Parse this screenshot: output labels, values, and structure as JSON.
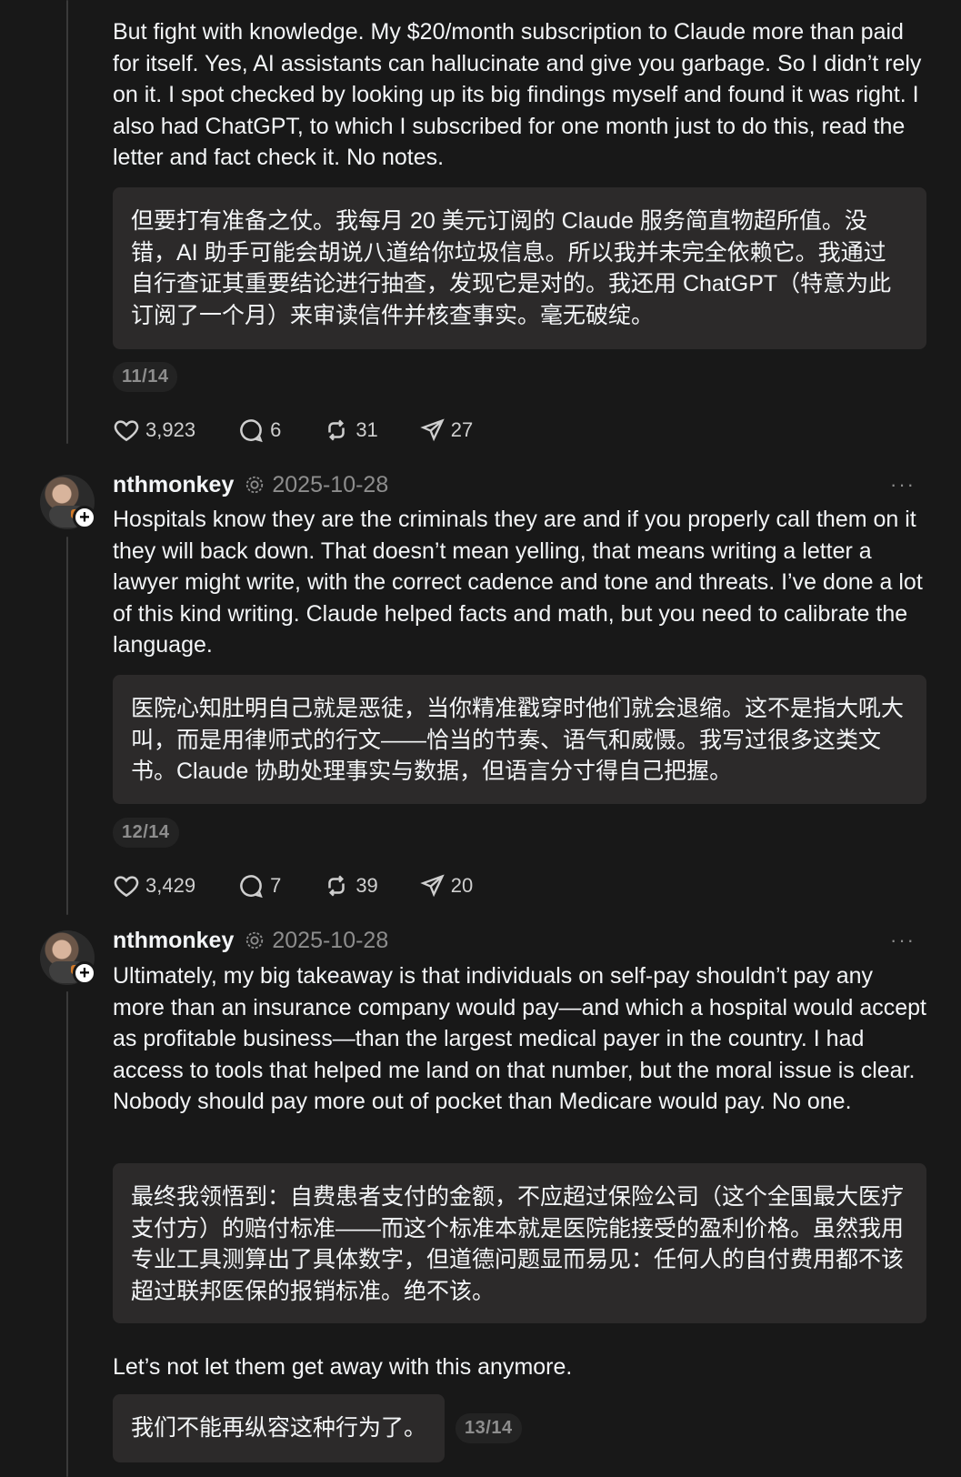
{
  "posts": [
    {
      "body": "But fight with knowledge. My $20/month subscription to Claude more than paid for itself. Yes, AI assistants can hallucinate and give you garbage. So I didn’t rely on it. I spot checked by looking up its big findings myself and found it was right. I also had ChatGPT, to which I subscribed for one month just to do this, read the letter and fact check it. No notes.",
      "translation": "但要打有准备之仗。我每月 20 美元订阅的 Claude 服务简直物超所值。没错，AI 助手可能会胡说八道给你垃圾信息。所以我并未完全依赖它。我通过自行查证其重要结论进行抽查，发现它是对的。我还用 ChatGPT（特意为此订阅了一个月）来审读信件并核查事实。毫无破绽。",
      "page": "11/14",
      "likes": "3,923",
      "replies": "6",
      "reposts": "31",
      "shares": "27"
    },
    {
      "username": "nthmonkey",
      "date": "2025-10-28",
      "body": "Hospitals know they are the criminals they are and if you properly call them on it they will back down. That doesn’t mean yelling, that means writing a letter a lawyer might write, with the correct cadence and tone and threats. I’ve done a lot of this kind writing. Claude helped        facts and math, but you need to calibrate the language.",
      "translation": "医院心知肚明自己就是恶徒，当你精准戳穿时他们就会退缩。这不是指大吼大叫，而是用律师式的行文——恰当的节奏、语气和威慑。我写过很多这类文书。Claude 协助处理事实与数据，但语言分寸得自己把握。",
      "page": "12/14",
      "likes": "3,429",
      "replies": "7",
      "reposts": "39",
      "shares": "20"
    },
    {
      "username": "nthmonkey",
      "date": "2025-10-28",
      "body": "Ultimately, my big takeaway is that individuals on self-pay shouldn’t pay any more than an insurance company would pay—and which a hospital would accept as profitable business—than the largest medical payer in the country. I had access to tools that helped me land on that number, but the moral issue is clear. Nobody should pay more out of pocket than Medicare would pay. No one.",
      "translation": "最终我领悟到：自费患者支付的金额，不应超过保险公司（这个全国最大医疗支付方）的赔付标准——而这个标准本就是医院能接受的盈利价格。虽然我用专业工具测算出了具体数字，但道德问题显而易见：任何人的自付费用都不该超过联邦医保的报销标准。绝不该。",
      "body2": "Let’s not let them get away with this anymore.",
      "translation2": "我们不能再纵容这种行为了。",
      "page": "13/14"
    }
  ],
  "icons": {
    "like": "heart-icon",
    "reply": "comment-icon",
    "repost": "repost-icon",
    "share": "share-icon",
    "more": "more-icon",
    "verified": "verified-icon",
    "follow": "plus-icon"
  },
  "labels": {
    "more": "···",
    "follow": "+"
  },
  "colors": {
    "background": "#181818",
    "translation_bg": "#2c2a2a",
    "muted": "#8d8d8d",
    "text": "#f3f5f7"
  }
}
